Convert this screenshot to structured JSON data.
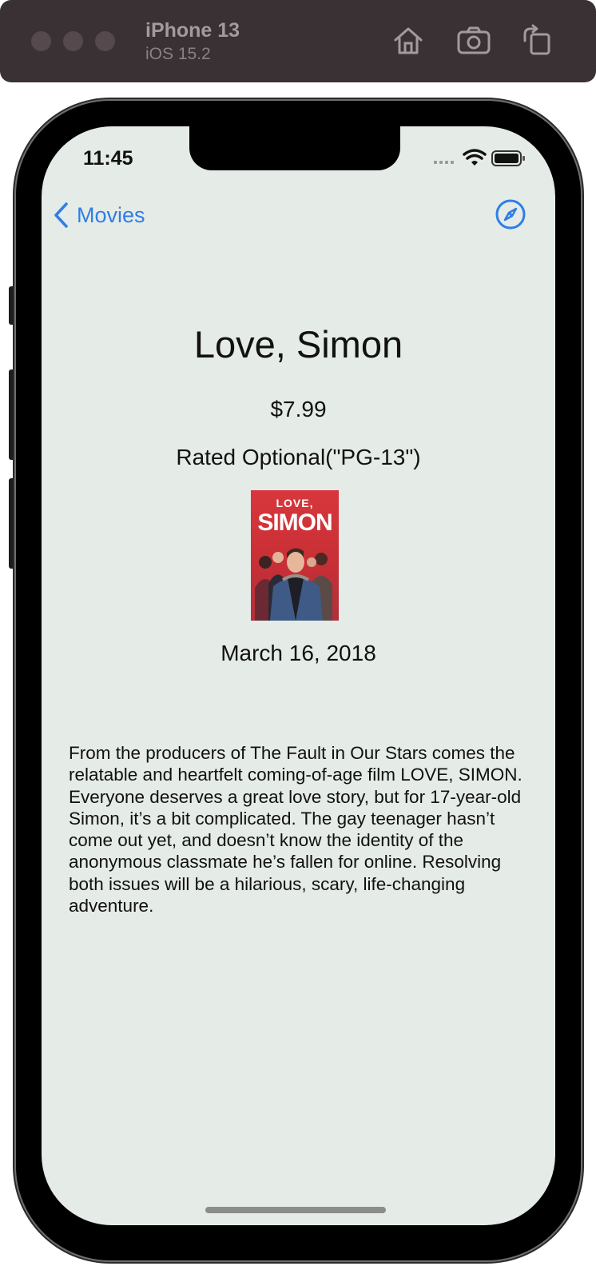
{
  "simulator": {
    "device_name": "iPhone 13",
    "os_version": "iOS 15.2",
    "toolbar_icons": [
      "home-icon",
      "screenshot-icon",
      "rotate-icon"
    ]
  },
  "status_bar": {
    "time": "11:45",
    "icons": [
      "cellular-icon",
      "wifi-icon",
      "battery-icon"
    ]
  },
  "nav": {
    "back_label": "Movies",
    "right_icon": "compass-icon",
    "accent_color": "#2f7ee6"
  },
  "movie": {
    "title": "Love, Simon",
    "price": "$7.99",
    "rating": "Rated Optional(\"PG-13\")",
    "poster": {
      "top_text": "LOVE,",
      "main_text": "SIMON"
    },
    "release_date": "March 16, 2018",
    "synopsis": "From the producers of The Fault in Our Stars comes the relatable and heartfelt coming-of-age film LOVE, SIMON. Everyone deserves a great love story, but for 17-year-old Simon, it’s a bit complicated. The gay teenager hasn’t come out yet, and doesn’t know the identity of the anonymous classmate he’s fallen for online. Resolving both issues will be a hilarious, scary, life-changing adventure."
  },
  "colors": {
    "screen_background": "#e5ebe7",
    "toolbar_background": "#3a3134"
  }
}
